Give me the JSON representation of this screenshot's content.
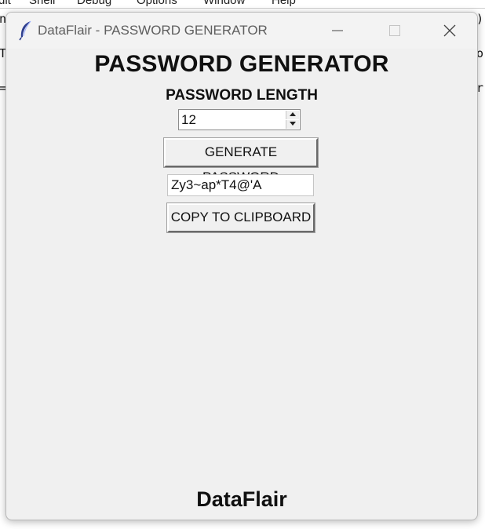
{
  "background_app": {
    "menu": [
      "dit",
      "Shell",
      "Debug",
      "Options",
      "Window",
      "Help"
    ],
    "code_fragments": {
      "left": [
        "n",
        "T",
        "="
      ],
      "right": [
        ")",
        "o",
        "r"
      ]
    }
  },
  "window": {
    "title": "DataFlair - PASSWORD GENERATOR",
    "icon": "feather-icon",
    "controls": {
      "minimize_icon": "minimize-icon",
      "maximize_icon": "maximize-icon",
      "close_icon": "close-icon"
    }
  },
  "app": {
    "heading": "PASSWORD GENERATOR",
    "length_label": "PASSWORD LENGTH",
    "length_value": "12",
    "generate_label": "GENERATE PASSWORD",
    "password_value": "Zy3~ap*T4@'A",
    "copy_label": "COPY TO CLIPBOARD",
    "footer": "DataFlair"
  }
}
